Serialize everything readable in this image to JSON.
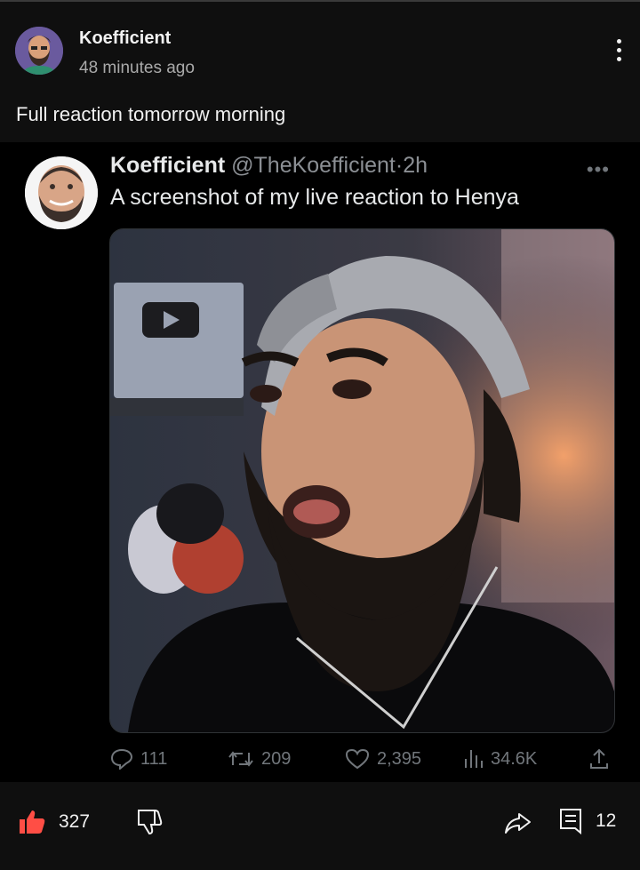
{
  "post": {
    "author": "Koefficient",
    "time": "48 minutes ago",
    "text": "Full reaction tomorrow morning"
  },
  "tweet": {
    "name": "Koefficient",
    "handle": "@TheKoefficient",
    "time": "2h",
    "text": "A screenshot of my live reaction to Henya",
    "stats": {
      "replies": "111",
      "retweets": "209",
      "likes": "2,395",
      "views": "34.6K"
    }
  },
  "actions": {
    "likes": "327",
    "comments": "12"
  },
  "colors": {
    "background": "#0f0f0f",
    "tweet_background": "#000000",
    "like_accent": "#ff4e45",
    "muted": "#71767b"
  },
  "icons": [
    "more-vert-icon",
    "more-horiz-icon",
    "reply-icon",
    "retweet-icon",
    "heart-icon",
    "views-icon",
    "share-icon",
    "thumb-up-icon",
    "thumb-down-icon",
    "share-arrow-icon",
    "comment-icon"
  ]
}
